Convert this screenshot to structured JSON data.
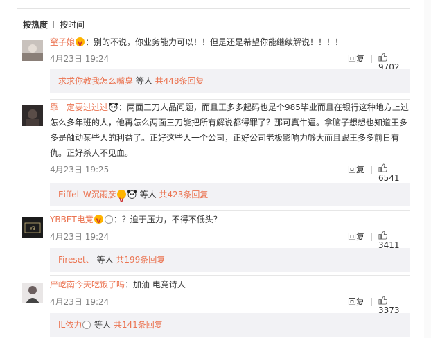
{
  "sort": {
    "hot_label": "按热度",
    "time_label": "按时间"
  },
  "comments": [
    {
      "username": "窒子娘",
      "text": "：别的不说，你业务能力可以！！但是还是希望你能继续解说！！！！",
      "time": "4月23日 19:24",
      "reply_label": "回复",
      "likes": "9702",
      "replies": {
        "name": "求求你教我怎么嘴臭",
        "mid": " 等人 ",
        "count": "共448条回复"
      }
    },
    {
      "username": "靠一定要过过过",
      "text": "：两面三刀人品问题，而且王多多起码也是个985毕业而且在银行这种地方上过怎么多年班的人，他再怎么两面三刀能把所有解说都得罪了？那可真牛逼。拿脑子想想也知道王多多是触动某些人的利益了。正好这些人一个公司，正好公司老板影响力够大而且跟王多多前日有仇。正好杀人不见血。",
      "time": "4月23日 19:25",
      "reply_label": "回复",
      "likes": "6541",
      "replies": {
        "name": "Eiffel_W沉雨彦",
        "mid": " 等人 ",
        "count": "共423条回复"
      }
    },
    {
      "username": "YBBET电竞",
      "text": "：？迫于压力，不得不低头？",
      "time": "4月23日 19:24",
      "reply_label": "回复",
      "likes": "3411",
      "replies": {
        "name": "Fireset、",
        "mid": " 等人 ",
        "count": "共199条回复"
      }
    },
    {
      "username": "严屹南今天吃饭了吗",
      "text": "：加油 电竞诗人",
      "time": "4月23日 19:24",
      "reply_label": "回复",
      "likes": "3373",
      "replies": {
        "name": "IL依力",
        "mid": " 等人 ",
        "count": "共141条回复"
      }
    }
  ],
  "colors": {
    "username": "#eb7350",
    "meta": "#808080",
    "reply_bg": "#f2f2f5"
  }
}
